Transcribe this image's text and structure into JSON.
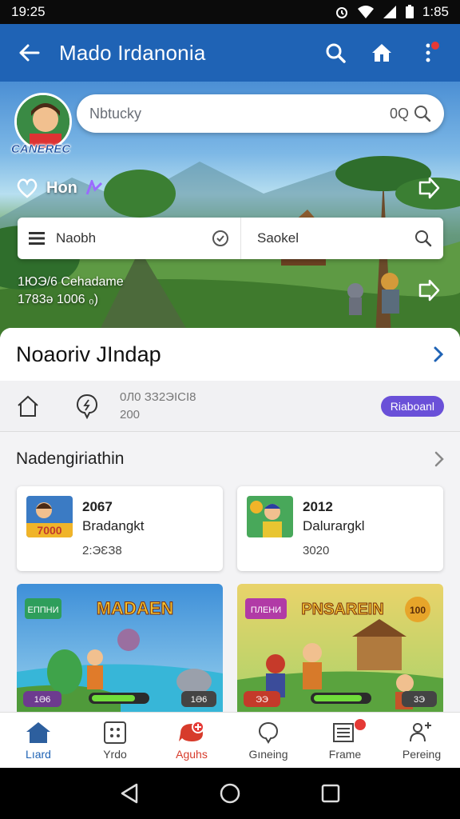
{
  "status": {
    "time": "19:25",
    "battery": "1:85"
  },
  "app_bar": {
    "title": "Mado Irdanonia"
  },
  "profile": {
    "tag": "CANEREC"
  },
  "search": {
    "placeholder": "Nbtucky",
    "value": "0Q"
  },
  "fav": {
    "label": "Hon"
  },
  "filter": {
    "left_label": "Naobh",
    "right_label": "Saokel"
  },
  "hero_stats": {
    "line1": "1ЮЭ/6 Cehadame",
    "line2": "1783ə 1006 ₀)"
  },
  "section": {
    "title": "Noaoriv JIndap",
    "info_line1": "0Л0 ЗЗ2ЭІСІ8",
    "info_line2": "200",
    "pill": "Riaboanl"
  },
  "subsection": {
    "title": "Nadengiriathin"
  },
  "cards": [
    {
      "year": "2067",
      "name": "Bradangkt",
      "sub": "2:ЭƐЗ8",
      "thumb_text": "7000"
    },
    {
      "year": "2012",
      "name": "Dalurargkl",
      "sub": "3020"
    }
  ],
  "banners": [
    {
      "title": "MADAEN",
      "sign": "ЕППНИ",
      "left_chip": "1Ә6",
      "right_chip": "1Ә6"
    },
    {
      "title": "PNSAREIN",
      "sign": "ПЛЕНИ",
      "coin": "100",
      "left_chip": "ЭЭ",
      "right_chip": "3Э"
    }
  ],
  "bottom_nav": [
    {
      "label": "Lıard",
      "icon": "home-icon"
    },
    {
      "label": "Yrdo",
      "icon": "grid-icon"
    },
    {
      "label": "Aguhs",
      "icon": "alert-icon"
    },
    {
      "label": "Gıneing",
      "icon": "chat-icon"
    },
    {
      "label": "Frame",
      "icon": "list-icon"
    },
    {
      "label": "Pereing",
      "icon": "people-icon"
    }
  ],
  "colors": {
    "primary": "#1f63b5",
    "accent": "#6a50d8",
    "alert": "#e53935"
  }
}
